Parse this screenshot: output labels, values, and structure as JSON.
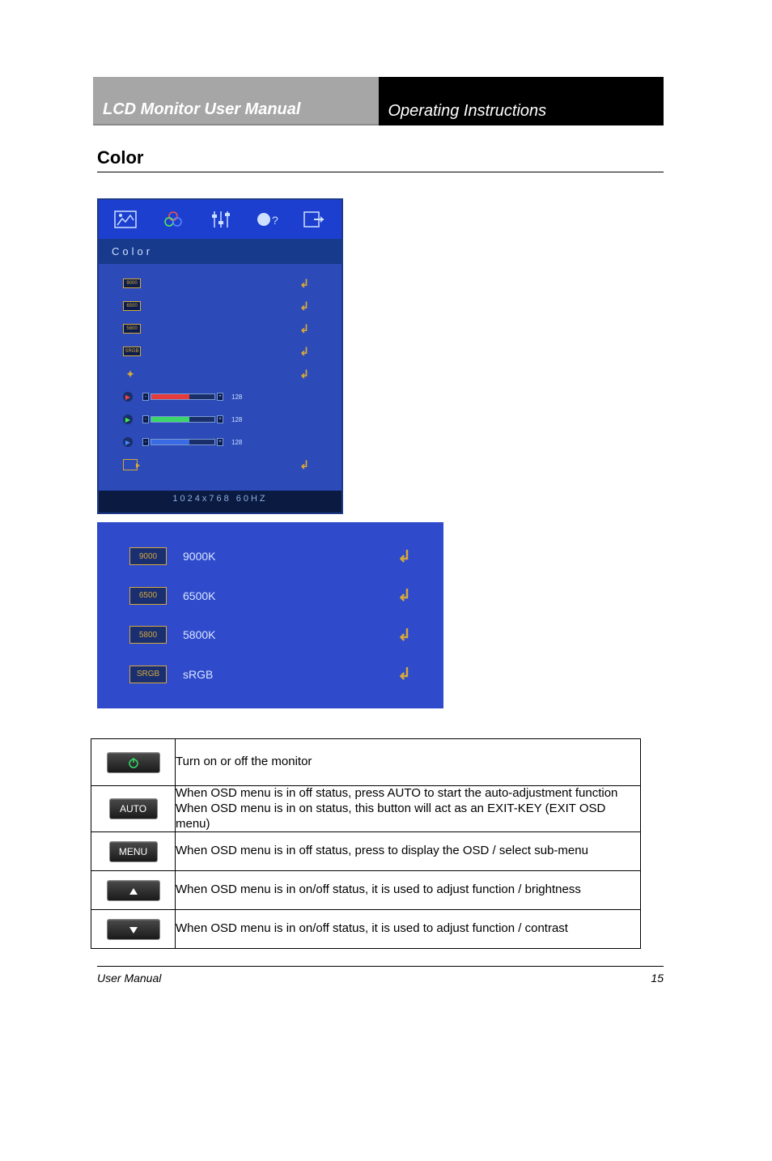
{
  "header": {
    "left": "LCD Monitor User Manual",
    "right": "Operating Instructions"
  },
  "section_title": "Color",
  "osd": {
    "title": "Color",
    "rows": {
      "preset1": "9000",
      "preset2": "6500",
      "preset3": "5800",
      "preset4": "SRGB",
      "barval_red": "128",
      "barval_green": "128",
      "barval_blue": "128"
    },
    "footer": "1024x768   60HZ"
  },
  "closeup": [
    {
      "chip": "9000",
      "label": "9000K"
    },
    {
      "chip": "6500",
      "label": "6500K"
    },
    {
      "chip": "5800",
      "label": "5800K"
    },
    {
      "chip": "SRGB",
      "label": "sRGB"
    }
  ],
  "table": {
    "power": "Turn on or off the monitor",
    "auto_l1": "When OSD menu is in off status, press AUTO to start the auto-adjustment function",
    "auto_l2": "When OSD menu is in on status, this button will act as an EXIT-KEY (EXIT OSD menu)",
    "menu": "When OSD menu is in off status, press to display the OSD / select sub-menu",
    "up": "When OSD menu is in on/off status, it is used to adjust function / brightness",
    "down": "When OSD menu is in on/off status, it is used to adjust function / contrast"
  },
  "footer_left": "User Manual",
  "footer_right": "15"
}
